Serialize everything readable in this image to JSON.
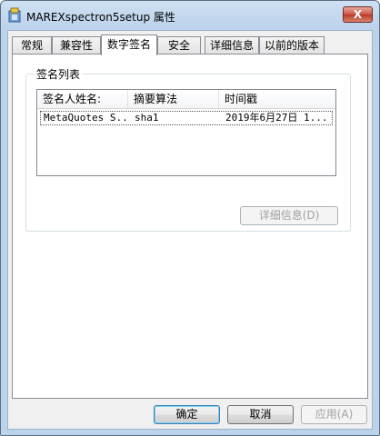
{
  "window": {
    "title": "MAREXspectron5setup 属性",
    "close_glyph": "X"
  },
  "tabs": [
    {
      "label": "常规"
    },
    {
      "label": "兼容性"
    },
    {
      "label": "数字签名",
      "active": true
    },
    {
      "label": "安全"
    },
    {
      "label": "详细信息"
    },
    {
      "label": "以前的版本"
    }
  ],
  "signature_list": {
    "group_label": "签名列表",
    "columns": [
      "签名人姓名:",
      "摘要算法",
      "时间戳"
    ],
    "rows": [
      {
        "signer": "MetaQuotes S...",
        "digest": "sha1",
        "timestamp": "2019年6月27日 1..."
      }
    ],
    "details_button": "详细信息(D)"
  },
  "buttons": {
    "ok": "确定",
    "cancel": "取消",
    "apply": "应用(A)"
  }
}
